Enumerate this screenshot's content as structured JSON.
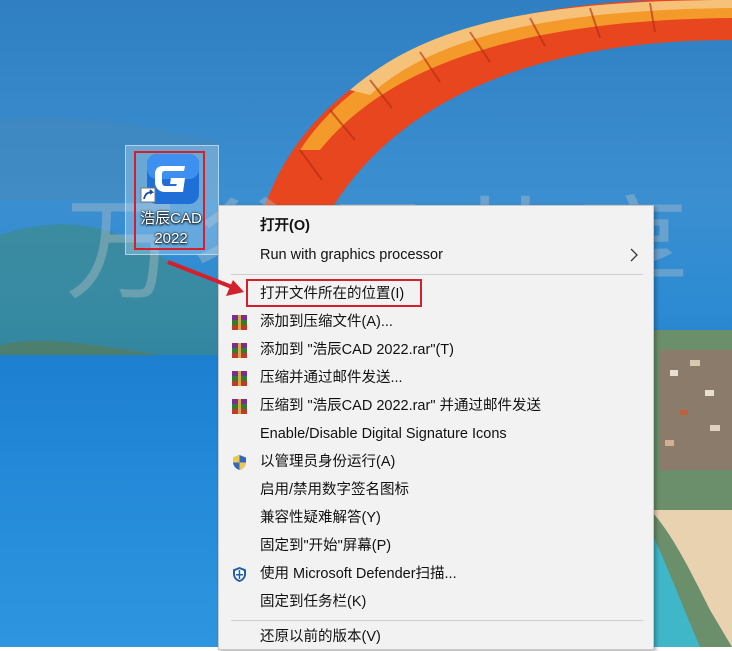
{
  "desktop": {
    "shortcut": {
      "label_line1": "浩辰CAD",
      "label_line2": "2022",
      "icon": "gstarcad-app-icon"
    },
    "watermark": "万谷云共享"
  },
  "context_menu": {
    "items": [
      {
        "label": "打开(O)",
        "bold": true,
        "icon": ""
      },
      {
        "label": "Run with graphics processor",
        "icon": "",
        "submenu": true
      },
      {
        "label": "打开文件所在的位置(I)",
        "icon": ""
      },
      {
        "label": "添加到压缩文件(A)...",
        "icon": "winrar-icon"
      },
      {
        "label": "添加到 \"浩辰CAD 2022.rar\"(T)",
        "icon": "winrar-icon"
      },
      {
        "label": "压缩并通过邮件发送...",
        "icon": "winrar-icon"
      },
      {
        "label": "压缩到 \"浩辰CAD 2022.rar\" 并通过邮件发送",
        "icon": "winrar-icon"
      },
      {
        "label": "Enable/Disable Digital Signature Icons",
        "icon": ""
      },
      {
        "label": "以管理员身份运行(A)",
        "icon": "uac-shield-icon"
      },
      {
        "label": "启用/禁用数字签名图标",
        "icon": ""
      },
      {
        "label": "兼容性疑难解答(Y)",
        "icon": ""
      },
      {
        "label": "固定到\"开始\"屏幕(P)",
        "icon": ""
      },
      {
        "label": "使用 Microsoft Defender扫描...",
        "icon": "defender-icon"
      },
      {
        "label": "固定到任务栏(K)",
        "icon": ""
      },
      {
        "label": "还原以前的版本(V)",
        "icon": ""
      }
    ]
  },
  "colors": {
    "highlight": "#d3202a",
    "menu_bg": "#f2f2f2",
    "sea": "#2389d8"
  }
}
